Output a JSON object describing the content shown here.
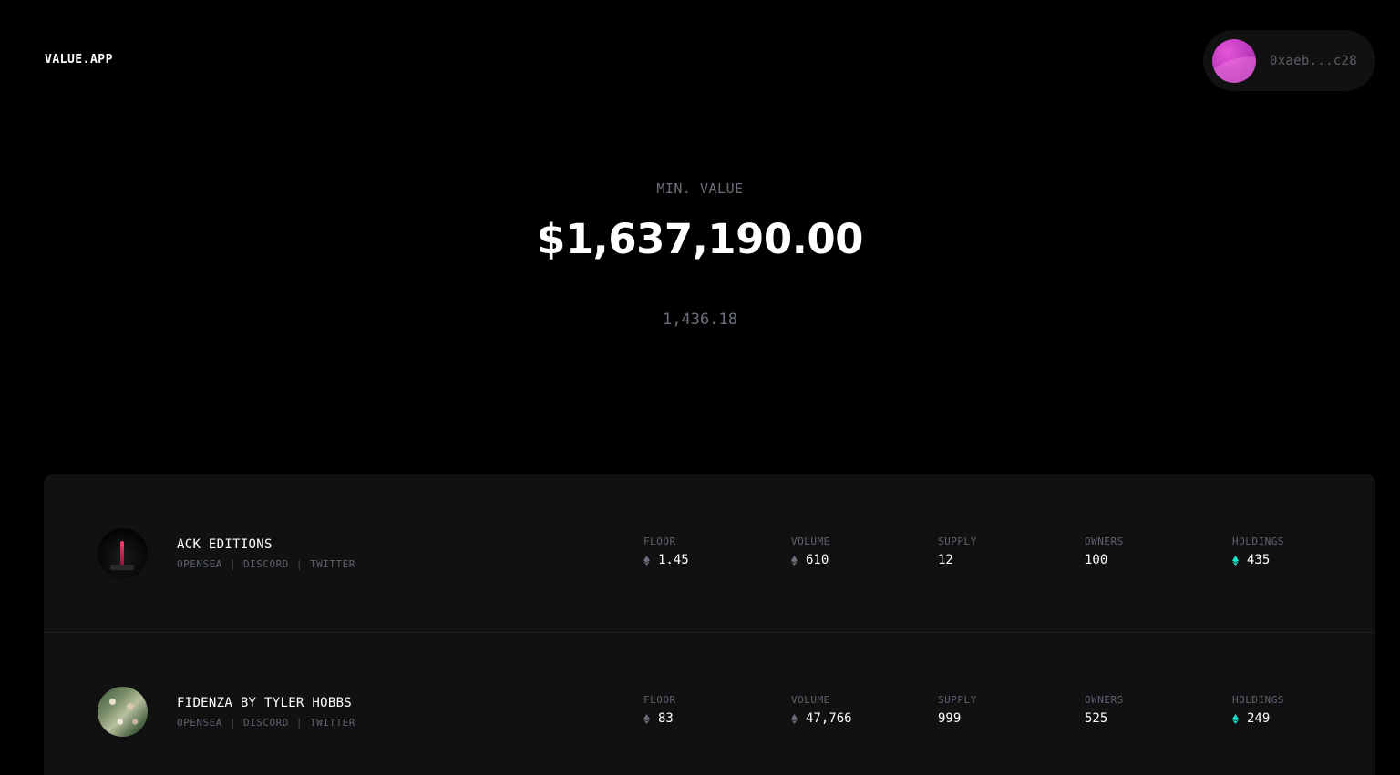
{
  "brand": {
    "logo": "VALUE.APP"
  },
  "wallet": {
    "address": "0xaeb...c28",
    "avatar_color": "#c43fc4"
  },
  "summary": {
    "label": "MIN. VALUE",
    "value": "$1,637,190.00",
    "eth_total": "1,436.18"
  },
  "columns": {
    "floor": "FLOOR",
    "volume": "VOLUME",
    "supply": "SUPPLY",
    "owners": "OWNERS",
    "holdings": "HOLDINGS"
  },
  "link_labels": {
    "opensea": "OPENSEA",
    "discord": "DISCORD",
    "twitter": "TWITTER",
    "separator": "|"
  },
  "collections": [
    {
      "name": "ACK EDITIONS",
      "floor": "1.45",
      "volume": "610",
      "supply": "12",
      "owners": "100",
      "holdings": "435"
    },
    {
      "name": "FIDENZA BY TYLER HOBBS",
      "floor": "83",
      "volume": "47,766",
      "supply": "999",
      "owners": "525",
      "holdings": "249"
    }
  ],
  "icons": {
    "eth_muted": "eth-icon",
    "eth_highlight": "eth-icon-cyan",
    "eth_highlight_color": "#19e3c8",
    "eth_muted_color": "#6b6f7b"
  }
}
